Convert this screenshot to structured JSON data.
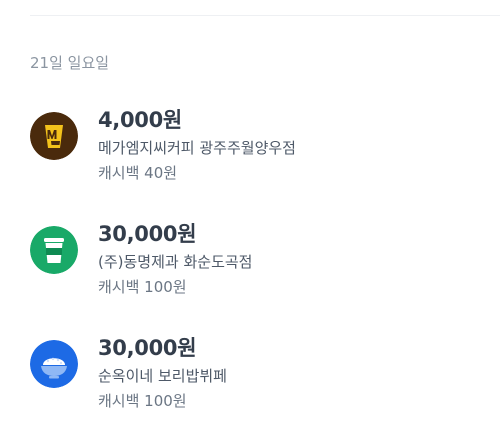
{
  "date_header": "21일 일요일",
  "colors": {
    "mega_coffee_bg": "#4a2a0c",
    "mega_coffee_fg": "#f3c21b",
    "cup_bg": "#19a968",
    "rice_bg": "#1d6ae5"
  },
  "transactions": [
    {
      "amount": "4,000원",
      "merchant": "메가엠지씨커피 광주주월양우점",
      "cashback": "캐시백 40원",
      "icon": "mega-coffee-logo"
    },
    {
      "amount": "30,000원",
      "merchant": "(주)동명제과 화순도곡점",
      "cashback": "캐시백 100원",
      "icon": "coffee-cup-icon"
    },
    {
      "amount": "30,000원",
      "merchant": "순옥이네 보리밥뷔페",
      "cashback": "캐시백 100원",
      "icon": "rice-bowl-icon"
    }
  ]
}
